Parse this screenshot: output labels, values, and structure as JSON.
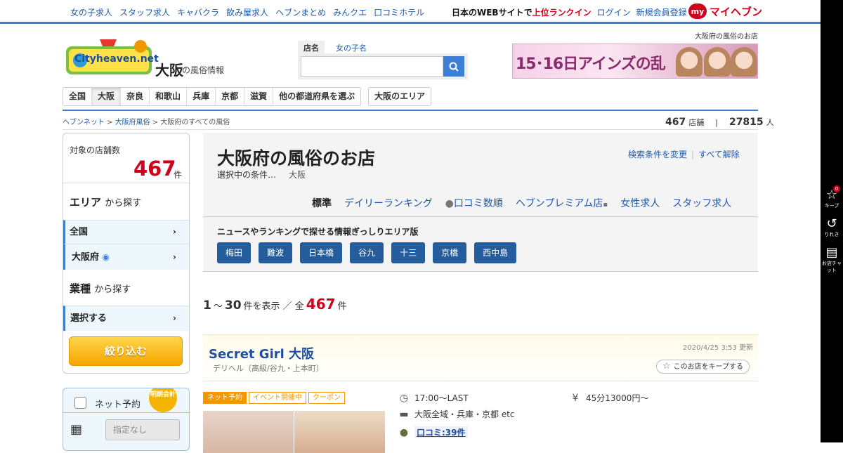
{
  "top": {
    "links": [
      "女の子求人",
      "スタッフ求人",
      "キャバクラ",
      "飲み屋求人",
      "ヘブンまとめ",
      "みんクエ",
      "口コミホテル"
    ],
    "rank_prefix": "日本のWEBサイトで",
    "rank_highlight": "上位ランクイン",
    "login": "ログイン",
    "register": "新規会員登録",
    "my_badge": "my",
    "my_label": "マイヘブン"
  },
  "side_tools": [
    {
      "label": "キープ",
      "count": "0"
    },
    {
      "label": "りれき"
    },
    {
      "label": "お店チャット"
    }
  ],
  "header": {
    "logo_text": "Cityheaven.net",
    "region": "大阪",
    "region_sub": "の風俗情報",
    "site_tag": "大阪府の風俗のお店",
    "search_tab_shop": "店名",
    "search_tab_girl": "女の子名",
    "search_value": "",
    "banner_text": "15･16日アインズの乱"
  },
  "regions": {
    "items": [
      "全国",
      "大阪",
      "奈良",
      "和歌山",
      "兵庫",
      "京都",
      "滋賀",
      "他の都道府県を選ぶ"
    ],
    "active": "大阪",
    "area_button": "大阪のエリア"
  },
  "breadcrumb": {
    "home": "ヘブンネット",
    "sep": ">",
    "pref": "大阪府風俗",
    "current": "大阪府のすべての風俗"
  },
  "counts": {
    "shops": "467",
    "shops_unit": "店舗",
    "people": "27815",
    "people_unit": "人"
  },
  "sidebar": {
    "count_label": "対象の店舗数",
    "count": "467",
    "count_unit": "件",
    "area_heading": "エリア",
    "area_suffix": "から探す",
    "area_rows": [
      "全国",
      "大阪府"
    ],
    "genre_heading": "業種",
    "genre_suffix": "から探す",
    "genre_row": "選択する",
    "filter_button": "絞り込む",
    "net_label": "ネット予約",
    "meido_badge": "明朗会計",
    "date_placeholder": "指定なし"
  },
  "panel": {
    "title": "大阪府の風俗のお店",
    "cond_label": "選択中の条件…",
    "cond_value": "大阪",
    "link_change": "検索条件を変更",
    "link_clear": "すべて解除",
    "sort_tabs": [
      "標準",
      "デイリーランキング",
      "口コミ数順",
      "ヘブンプレミアム店",
      "女性求人",
      "スタッフ求人"
    ],
    "area_title": "ニュースやランキングで探せる情報ぎっしりエリア版",
    "areas": [
      "梅田",
      "難波",
      "日本橋",
      "谷九",
      "十三",
      "京橋",
      "西中島"
    ]
  },
  "results": {
    "from": "1",
    "to": "30",
    "label": "件を表示 ／ 全",
    "total": "467",
    "unit": "件"
  },
  "shop": {
    "name": "Secret Girl 大阪",
    "updated": "2020/4/25 3:53 更新",
    "type": "デリヘル（高級/谷九・上本町）",
    "keep": "このお店をキープする",
    "tags": [
      "ネット予約",
      "イベント開催中",
      "クーポン"
    ],
    "hours": "17:00～LAST",
    "price": "45分13000円～",
    "area": "大阪全域・兵庫・京都 etc",
    "reviews": "口コミ:39件"
  }
}
